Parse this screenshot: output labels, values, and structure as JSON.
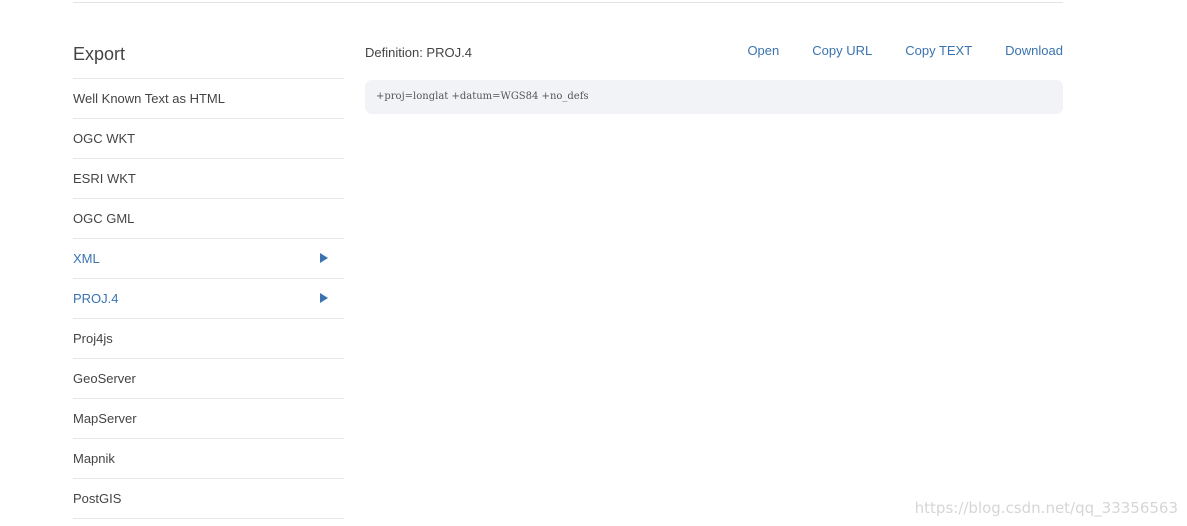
{
  "sidebar": {
    "title": "Export",
    "items": [
      {
        "label": "Well Known Text as HTML",
        "active": false,
        "arrow": false
      },
      {
        "label": "OGC WKT",
        "active": false,
        "arrow": false
      },
      {
        "label": "ESRI WKT",
        "active": false,
        "arrow": false
      },
      {
        "label": "OGC GML",
        "active": false,
        "arrow": false
      },
      {
        "label": "XML",
        "active": true,
        "arrow": true
      },
      {
        "label": "PROJ.4",
        "active": true,
        "arrow": true
      },
      {
        "label": "Proj4js",
        "active": false,
        "arrow": false
      },
      {
        "label": "GeoServer",
        "active": false,
        "arrow": false
      },
      {
        "label": "MapServer",
        "active": false,
        "arrow": false
      },
      {
        "label": "Mapnik",
        "active": false,
        "arrow": false
      },
      {
        "label": "PostGIS",
        "active": false,
        "arrow": false
      }
    ]
  },
  "main": {
    "definition_title": "Definition: PROJ.4",
    "actions": {
      "open": "Open",
      "copy_url": "Copy URL",
      "copy_text": "Copy TEXT",
      "download": "Download"
    },
    "code": "+proj=longlat +datum=WGS84 +no_defs"
  },
  "watermark": "https://blog.csdn.net/qq_33356563",
  "colors": {
    "link": "#3a73b0",
    "text": "#444444",
    "code_bg": "#f2f3f6",
    "divider": "#e6e6e6"
  },
  "icons": {
    "arrow": "caret-right-icon"
  }
}
